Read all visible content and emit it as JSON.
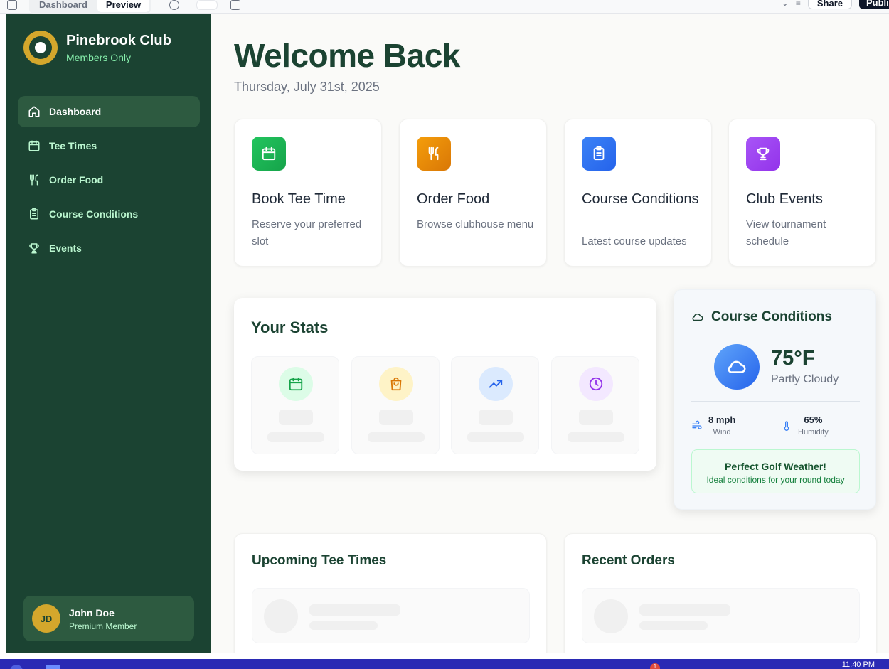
{
  "toolbar": {
    "tabs": [
      {
        "label": "Dashboard",
        "active": false
      },
      {
        "label": "Preview",
        "active": true
      }
    ],
    "share_label": "Share",
    "publish_label": "Publish"
  },
  "sidebar": {
    "brand_name": "Pinebrook Club",
    "brand_subtitle": "Members Only",
    "items": [
      {
        "label": "Dashboard",
        "icon": "home-icon",
        "active": true
      },
      {
        "label": "Tee Times",
        "icon": "calendar-icon",
        "active": false
      },
      {
        "label": "Order Food",
        "icon": "utensils-icon",
        "active": false
      },
      {
        "label": "Course Conditions",
        "icon": "clipboard-icon",
        "active": false
      },
      {
        "label": "Events",
        "icon": "trophy-icon",
        "active": false
      }
    ],
    "user": {
      "initials": "JD",
      "name": "John Doe",
      "role": "Premium Member"
    }
  },
  "main": {
    "title": "Welcome Back",
    "date": "Thursday, July 31st, 2025",
    "quick_actions": [
      {
        "title": "Book Tee Time",
        "description": "Reserve your preferred slot",
        "icon": "calendar-icon",
        "color": "#22c55e"
      },
      {
        "title": "Order Food",
        "description": "Browse clubhouse menu",
        "icon": "utensils-icon",
        "color": "#f59e0b"
      },
      {
        "title": "Course Conditions",
        "description": "Latest course updates",
        "icon": "clipboard-icon",
        "color": "#3b82f6"
      },
      {
        "title": "Club Events",
        "description": "View tournament schedule",
        "icon": "trophy-icon",
        "color": "#a855f7"
      }
    ],
    "stats": {
      "title": "Your Stats",
      "tiles": [
        {
          "icon": "calendar-icon",
          "color": "#16a34a",
          "bg": "#dcfce7"
        },
        {
          "icon": "shopping-bag-icon",
          "color": "#d97706",
          "bg": "#fef3c7"
        },
        {
          "icon": "trending-up-icon",
          "color": "#2563eb",
          "bg": "#dbeafe"
        },
        {
          "icon": "clock-icon",
          "color": "#9333ea",
          "bg": "#f3e8ff"
        }
      ]
    },
    "conditions": {
      "title": "Course Conditions",
      "temperature": "75°F",
      "summary": "Partly Cloudy",
      "wind_value": "8 mph",
      "wind_label": "Wind",
      "humidity_value": "65%",
      "humidity_label": "Humidity",
      "banner_title": "Perfect Golf Weather!",
      "banner_subtitle": "Ideal conditions for your round today"
    },
    "upcoming_title": "Upcoming Tee Times",
    "orders_title": "Recent Orders"
  },
  "taskbar": {
    "clock": "11:40 PM",
    "notification_count": "1"
  },
  "colors": {
    "sidebar_bg": "#1b4332",
    "accent_gold": "#d4a72c",
    "heading_green": "#1b4332"
  }
}
